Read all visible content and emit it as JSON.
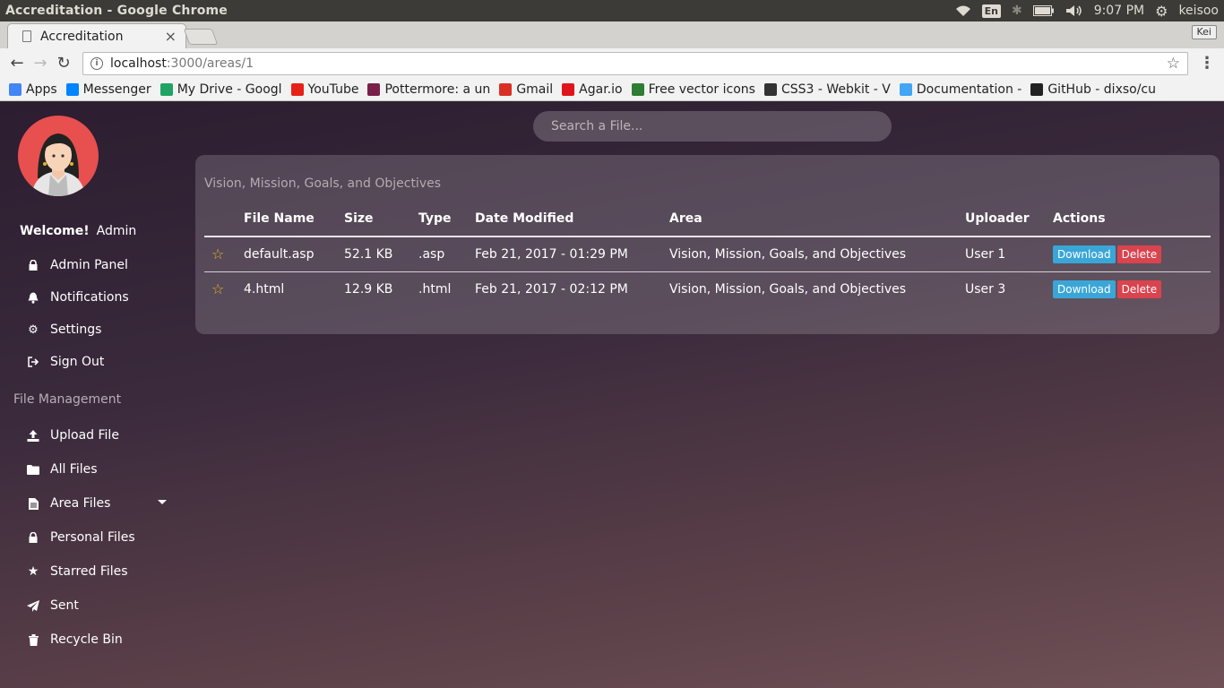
{
  "os": {
    "window_title": "Accreditation - Google Chrome",
    "lang": "En",
    "time": "9:07 PM",
    "user": "keisoo"
  },
  "browser": {
    "tab_title": "Accreditation",
    "tab_close": "×",
    "profile": "Kei",
    "url_host": "localhost",
    "url_path": ":3000/areas/1",
    "bookmarks": [
      {
        "label": "Apps",
        "icon": "apps-grid-icon",
        "color": "#4285f4"
      },
      {
        "label": "Messenger",
        "icon": "messenger-icon",
        "color": "#0084ff"
      },
      {
        "label": "My Drive - Googl",
        "icon": "drive-icon",
        "color": "#1fa463"
      },
      {
        "label": "YouTube",
        "icon": "youtube-icon",
        "color": "#e62117"
      },
      {
        "label": "Pottermore: a un",
        "icon": "pottermore-icon",
        "color": "#7a1f4a"
      },
      {
        "label": "Gmail",
        "icon": "gmail-icon",
        "color": "#d93025"
      },
      {
        "label": "Agar.io",
        "icon": "agar-icon",
        "color": "#e0151b"
      },
      {
        "label": "Free vector icons",
        "icon": "vector-icon",
        "color": "#2e7d32"
      },
      {
        "label": "CSS3 - Webkit - V",
        "icon": "css3-icon",
        "color": "#333333"
      },
      {
        "label": "Documentation -",
        "icon": "docs-icon",
        "color": "#42a5f5"
      },
      {
        "label": "GitHub - dixso/cu",
        "icon": "github-icon",
        "color": "#222222"
      }
    ]
  },
  "sidebar": {
    "welcome": "Welcome!",
    "username": "Admin",
    "account_items": [
      {
        "label": "Admin Panel",
        "icon": "lock-icon"
      },
      {
        "label": "Notifications",
        "icon": "bell-icon"
      },
      {
        "label": "Settings",
        "icon": "gears-icon"
      },
      {
        "label": "Sign Out",
        "icon": "sign-out-icon"
      }
    ],
    "section_title": "File Management",
    "file_items": [
      {
        "label": "Upload File",
        "icon": "upload-icon"
      },
      {
        "label": "All Files",
        "icon": "folder-icon"
      },
      {
        "label": "Area Files",
        "icon": "file-icon"
      },
      {
        "label": "Personal Files",
        "icon": "lock-icon"
      },
      {
        "label": "Starred Files",
        "icon": "star-icon"
      },
      {
        "label": "Sent",
        "icon": "paper-plane-icon"
      },
      {
        "label": "Recycle Bin",
        "icon": "trash-icon"
      }
    ]
  },
  "search": {
    "placeholder": "Search a File..."
  },
  "panel": {
    "title": "Vision, Mission, Goals, and Objectives",
    "columns": [
      "",
      "File Name",
      "Size",
      "Type",
      "Date Modified",
      "Area",
      "Uploader",
      "Actions"
    ],
    "rows": [
      {
        "name": "default.asp",
        "size": "52.1 KB",
        "type": ".asp",
        "date": "Feb 21, 2017 - 01:29 PM",
        "area": "Vision, Mission, Goals, and Objectives",
        "uploader": "User 1"
      },
      {
        "name": "4.html",
        "size": "12.9 KB",
        "type": ".html",
        "date": "Feb 21, 2017 - 02:12 PM",
        "area": "Vision, Mission, Goals, and Objectives",
        "uploader": "User 3"
      }
    ],
    "download_label": "Download",
    "delete_label": "Delete"
  },
  "colors": {
    "download": "#3aa6d8",
    "delete": "#d9444f",
    "star": "#e6b422",
    "avatar_bg": "#e84f4f"
  }
}
